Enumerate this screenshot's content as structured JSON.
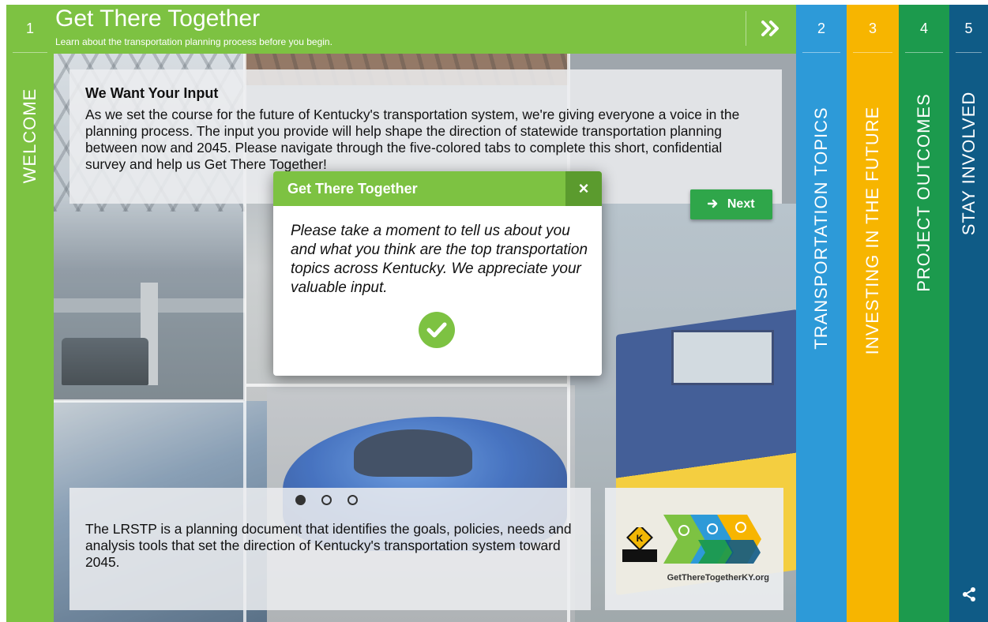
{
  "header": {
    "title": "Get There Together",
    "subtitle": "Learn about the transportation planning process before you begin.",
    "next_icon": "double-chevron-right-icon"
  },
  "tabs": [
    {
      "number": "1",
      "label": "WELCOME",
      "color": "#7dc242"
    },
    {
      "number": "2",
      "label": "TRANSPORTATION TOPICS",
      "color": "#2d9ad8"
    },
    {
      "number": "3",
      "label": "INVESTING IN THE FUTURE",
      "color": "#f7b500"
    },
    {
      "number": "4",
      "label": "PROJECT OUTCOMES",
      "color": "#1c9a4d"
    },
    {
      "number": "5",
      "label": "STAY INVOLVED",
      "color": "#0f5b86"
    }
  ],
  "intro": {
    "heading": "We Want Your Input",
    "body": "As we set the course for the future of Kentucky's transportation system, we're giving everyone a voice in the planning process. The input you provide will help shape the direction of statewide transportation planning between now and 2045. Please navigate through the five-colored tabs to complete this short, confidential survey and help us Get There Together!"
  },
  "next_button": {
    "label": "Next",
    "icon": "arrow-right-icon"
  },
  "carousel": {
    "slides": 3,
    "active": 1
  },
  "bottom": {
    "body": "The LRSTP is a planning document that identifies the goals, policies, needs and analysis tools that set the direction of Kentucky's transportation system toward 2045."
  },
  "logo": {
    "url": "GetThereTogetherKY.org"
  },
  "modal": {
    "title": "Get There Together",
    "close_label": "×",
    "body": "Please take a moment to tell us about you and what you think are the top transportation topics across Kentucky. We appreciate your valuable input.",
    "confirm_icon": "checkmark-icon"
  },
  "colors": {
    "brand_green": "#7dc242",
    "button_green": "#2fa64a",
    "close_green": "#5b9b2e"
  }
}
